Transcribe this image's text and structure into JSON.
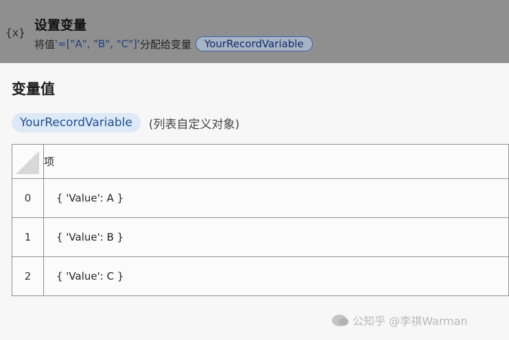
{
  "action": {
    "icon": "{x}",
    "icon_name": "variable-icon",
    "title": "设置变量",
    "desc_prefix": "将值 ",
    "desc_value": "'=[\"A\", \"B\", \"C\"]'",
    "desc_suffix": " 分配给变量",
    "variable": "YourRecordVariable"
  },
  "panel": {
    "title": "变量值",
    "variable": "YourRecordVariable",
    "type_label": "(列表自定义对象)"
  },
  "table": {
    "header": "项",
    "rows": [
      {
        "index": "0",
        "value": "{ 'Value': A }"
      },
      {
        "index": "1",
        "value": "{ 'Value': B }"
      },
      {
        "index": "2",
        "value": "{ 'Value': C }"
      }
    ]
  },
  "watermark": {
    "text": "公知乎 @李祺Warman"
  },
  "colors": {
    "accent": "#1d4f91",
    "pill_bg": "#dde9f7",
    "header_dim": "#8f8f8f"
  }
}
